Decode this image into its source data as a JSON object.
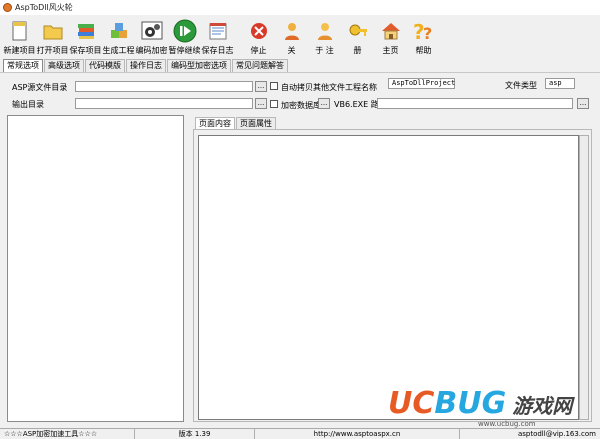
{
  "window": {
    "title": "AspToDll风火轮"
  },
  "toolbar": {
    "new_project": "新建项目",
    "open_project": "打开项目",
    "save_project": "保存项目",
    "build": "生成工程",
    "encrypt": "编码加密",
    "pause": "暂停继续",
    "save_log": "保存日志",
    "stop": "停止",
    "close": "关",
    "about": "于 注",
    "register": "册",
    "home": "主页",
    "help": "帮助"
  },
  "tabs": [
    "常规选项",
    "高级选项",
    "代码模版",
    "操作日志",
    "编码型加密选项",
    "常见问题解答"
  ],
  "fields": {
    "asp_dir_label": "ASP源文件目录",
    "asp_dir_value": "",
    "output_dir_label": "输出目录",
    "output_dir_value": "",
    "auto_copy_label": "自动拷贝其他文件",
    "encrypt_db_label": "加密数据库",
    "project_name_label": "工程名称",
    "project_name_value": "AspToDllProject",
    "file_type_label": "文件类型",
    "file_type_value": "asp",
    "vb_path_label": "VB6.EXE 路径",
    "vb_path_value": "",
    "browse": "..."
  },
  "sub_tabs": [
    "页面内容",
    "页面属性"
  ],
  "watermark": {
    "uc": "UC",
    "bug": "BUG",
    "cn": "游戏网",
    "url": "www.ucbug.com"
  },
  "status": {
    "product": "☆☆☆ASP加密加速工具☆☆☆",
    "version": "版本 1.39",
    "website": "http://www.asptoaspx.cn",
    "email": "asptodll@vip.163.com"
  },
  "colors": {
    "accent_orange": "#e85a24",
    "accent_blue": "#27a7e0"
  }
}
